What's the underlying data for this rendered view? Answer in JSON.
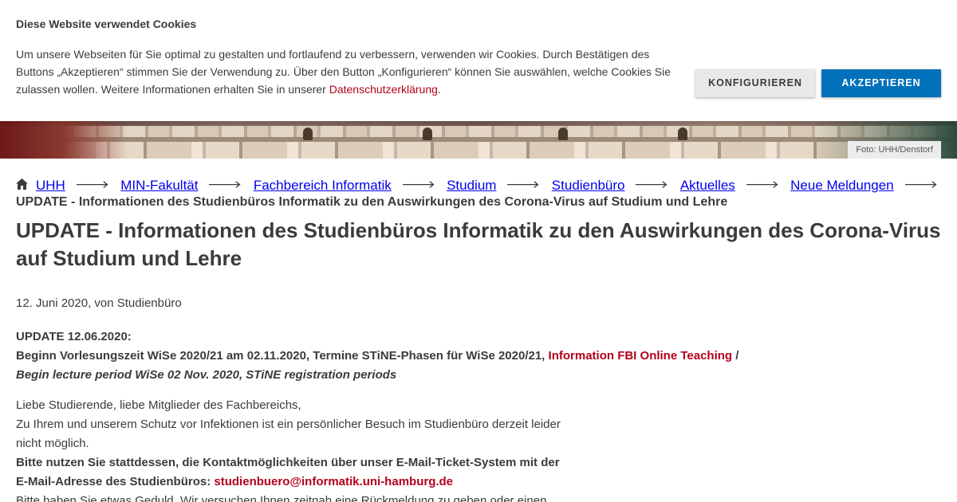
{
  "cookie": {
    "title": "Diese Website verwendet Cookies",
    "text_before_link": "Um unsere Webseiten für Sie optimal zu gestalten und fortlaufend zu verbessern, verwenden wir Cookies. Durch Bestätigen des Buttons „Akzeptieren“ stimmen Sie der Verwendung zu. Über den Button „Konfigurieren“ können Sie auswählen, welche Cookies Sie zulassen wollen. Weitere Informationen erhalten Sie in unserer ",
    "privacy_link": "Datenschutzerklärung",
    "text_after_link": ".",
    "configure_label": "KONFIGURIEREN",
    "accept_label": "AKZEPTIEREN"
  },
  "hero": {
    "photo_credit": "Foto: UHH/Denstorf"
  },
  "breadcrumb": {
    "items": [
      "UHH",
      "MIN-Fakultät",
      "Fachbereich Informatik",
      "Studium",
      "Studienbüro",
      "Aktuelles",
      "Neue Meldungen"
    ],
    "current": "UPDATE - Informationen des Studienbüros Informatik zu den Auswirkungen des Corona-Virus auf Studium und Lehre"
  },
  "article": {
    "title": "UPDATE - Informationen des Studienbüros Informatik zu den Auswirkungen des Corona-Virus auf Studium und Lehre",
    "meta": "12. Juni 2020, von Studienbüro",
    "update_heading": "UPDATE 12.06.2020:",
    "update_line": "Beginn Vorlesungszeit WiSe 2020/21 am 02.11.2020, Termine STiNE-Phasen für WiSe 2020/21, ",
    "update_link": "Information FBI Online Teaching",
    "update_slash": " /",
    "update_english": "Begin lecture period WiSe 02 Nov.  2020, STiNE registration periods",
    "greeting": "Liebe Studierende, liebe Mitglieder des Fachbereichs,",
    "para1": "Zu Ihrem und unserem Schutz vor Infektionen ist ein persönlicher Besuch im Studienbüro derzeit leider nicht möglich.",
    "para2_bold": "Bitte nutzen Sie stattdessen, die Kontaktmöglichkeiten über unser E-Mail-Ticket-System mit der E-Mail-Adresse des Studienbüros: ",
    "email_link": "studienbuero@informatik.uni-hamburg.de",
    "para3": "Bitte haben Sie etwas Geduld. Wir versuchen Ihnen zeitnah eine Rückmeldung zu geben oder einen"
  },
  "colors": {
    "accent_red": "#b3001b",
    "accept_blue": "#0271bb",
    "text": "#3b3b3b"
  }
}
